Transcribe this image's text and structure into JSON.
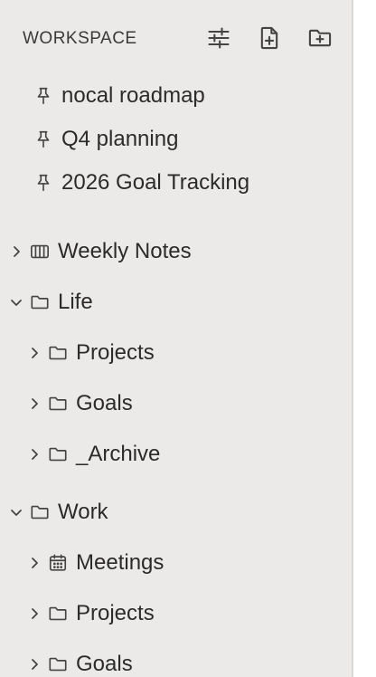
{
  "header": {
    "title": "WORKSPACE"
  },
  "pinned": [
    {
      "label": "nocal roadmap",
      "icon": "pin-icon"
    },
    {
      "label": "Q4 planning",
      "icon": "pin-icon"
    },
    {
      "label": "2026 Goal Tracking",
      "icon": "pin-icon"
    }
  ],
  "tree": [
    {
      "label": "Weekly Notes",
      "icon": "columns-icon",
      "expanded": false,
      "level": 0
    },
    {
      "label": "Life",
      "icon": "folder-icon",
      "expanded": true,
      "level": 0
    },
    {
      "label": "Projects",
      "icon": "folder-icon",
      "expanded": false,
      "level": 1
    },
    {
      "label": "Goals",
      "icon": "folder-icon",
      "expanded": false,
      "level": 1
    },
    {
      "label": "_Archive",
      "icon": "folder-icon",
      "expanded": false,
      "level": 1
    },
    {
      "label": "Work",
      "icon": "folder-icon",
      "expanded": true,
      "level": 0
    },
    {
      "label": "Meetings",
      "icon": "calendar-icon",
      "expanded": false,
      "level": 1
    },
    {
      "label": "Projects",
      "icon": "folder-icon",
      "expanded": false,
      "level": 1
    },
    {
      "label": "Goals",
      "icon": "folder-icon",
      "expanded": false,
      "level": 1
    }
  ],
  "colors": {
    "sidebar_bg": "#ebeae8",
    "text": "#2b2b2b",
    "icon": "#444444"
  }
}
